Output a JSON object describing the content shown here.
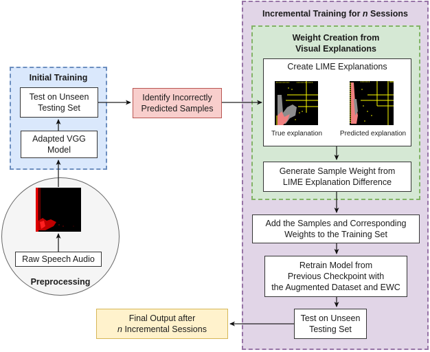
{
  "groups": {
    "incremental_title_pre": "Incremental Training for ",
    "incremental_title_var": "n",
    "incremental_title_post": " Sessions",
    "weight_creation_title": "Weight Creation from\nVisual Explanations",
    "initial_title": "Initial Training",
    "preprocessing_title": "Preprocessing"
  },
  "nodes": {
    "test_initial": "Test on Unseen\nTesting Set",
    "adapted_vgg": "Adapted VGG\nModel",
    "raw_audio": "Raw Speech Audio",
    "identify": "Identify Incorrectly\nPredicted Samples",
    "create_lime": "Create LIME Explanations",
    "true_caption": "True explanation",
    "pred_caption": "Predicted explanation",
    "generate_weight": "Generate Sample Weight from\nLIME Explanation Difference",
    "add_samples": "Add the Samples and Corresponding\nWeights to the Training Set",
    "retrain": "Retrain Model from\nPrevious Checkpoint with\nthe Augmented Dataset and EWC",
    "test_final": "Test on Unseen\nTesting Set",
    "final_pre_line": "Final Output after",
    "final_var": "n",
    "final_post": " Incremental Sessions"
  },
  "colors": {
    "incremental_fill": "#e1d5e7",
    "incremental_border": "#9673a6",
    "weight_fill": "#d5e8d4",
    "weight_border": "#82b366",
    "initial_fill": "#dae8fc",
    "initial_border": "#6c8ebf",
    "identify_fill": "#f8cecc",
    "final_fill": "#fff2cc"
  }
}
